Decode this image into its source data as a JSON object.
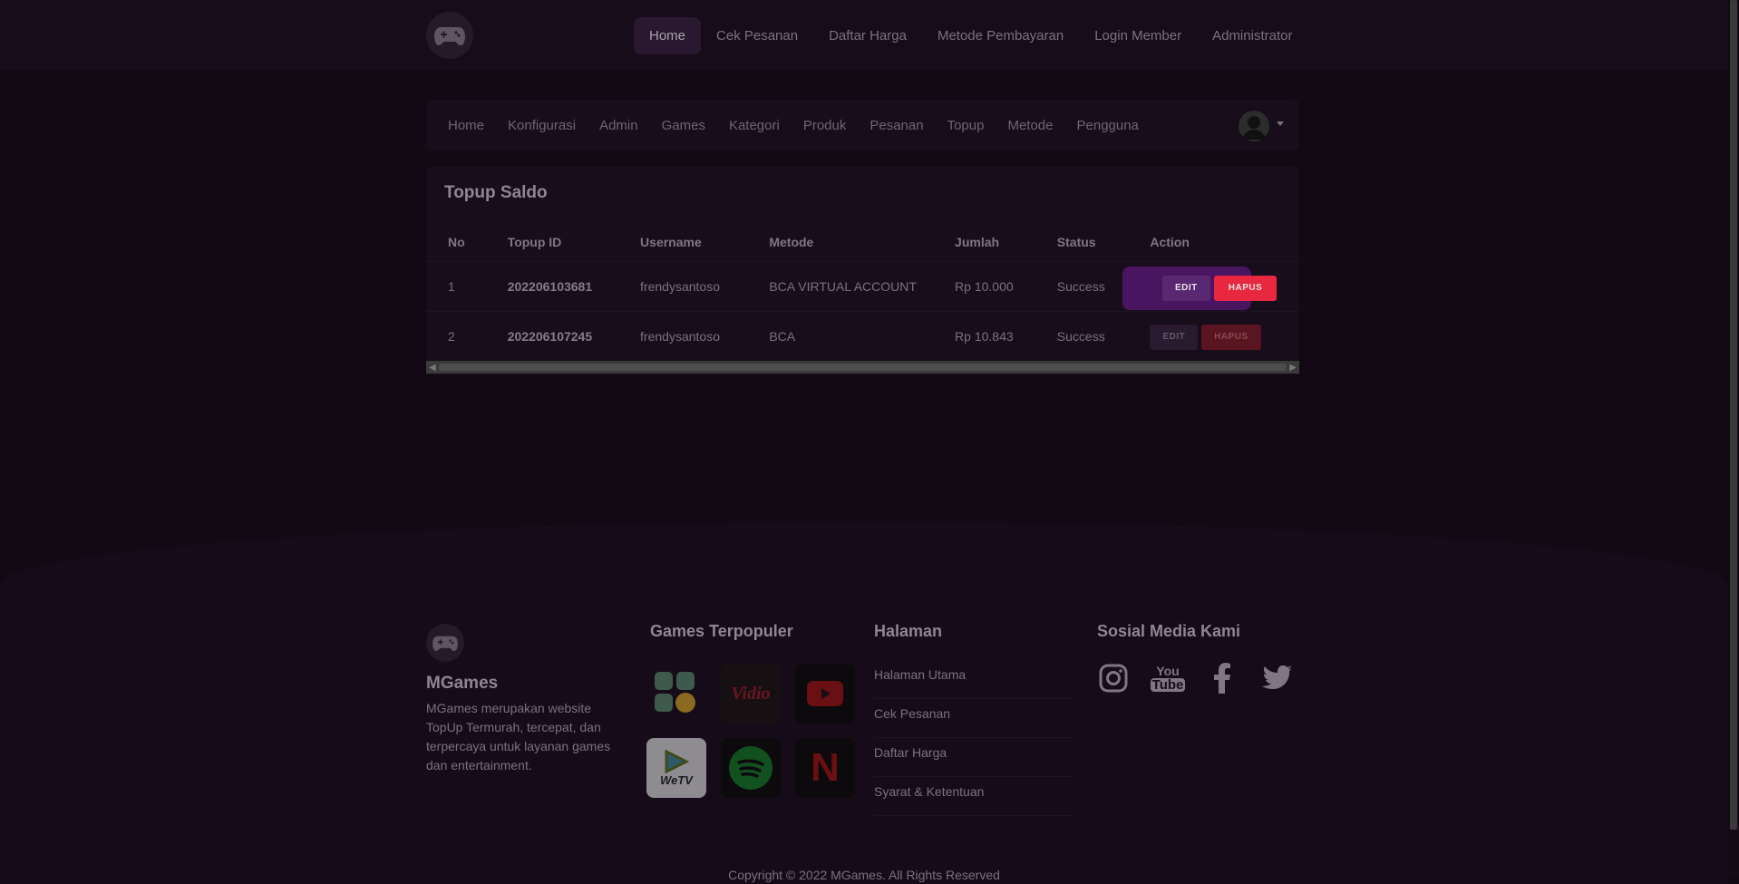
{
  "nav": {
    "items": [
      "Home",
      "Cek Pesanan",
      "Daftar Harga",
      "Metode Pembayaran",
      "Login Member",
      "Administrator"
    ],
    "active": "Home"
  },
  "admin_nav": {
    "items": [
      "Home",
      "Konfigurasi",
      "Admin",
      "Games",
      "Kategori",
      "Produk",
      "Pesanan",
      "Topup",
      "Metode",
      "Pengguna"
    ]
  },
  "card": {
    "title": "Topup Saldo",
    "columns": [
      "No",
      "Topup ID",
      "Username",
      "Metode",
      "Jumlah",
      "Status",
      "Action"
    ],
    "rows": [
      {
        "no": "1",
        "id": "202206103681",
        "username": "frendysantoso",
        "metode": "BCA VIRTUAL ACCOUNT",
        "jumlah": "Rp 10.000",
        "status": "Success"
      },
      {
        "no": "2",
        "id": "202206107245",
        "username": "frendysantoso",
        "metode": "BCA",
        "jumlah": "Rp 10.843",
        "status": "Success"
      }
    ],
    "edit_label": "EDIT",
    "hapus_label": "HAPUS"
  },
  "footer": {
    "brand": "MGames",
    "description": "MGames merupakan website TopUp Termurah, tercepat, dan terpercaya untuk layanan games dan entertainment.",
    "games_heading": "Games Terpopuler",
    "games": [
      {
        "name": "apps-coin-icon",
        "label": "",
        "bg": "#1a1a1a"
      },
      {
        "name": "vidio-icon",
        "label": "Vidio",
        "bg": "#1a1a1a"
      },
      {
        "name": "youtube-icon",
        "label": "",
        "bg": "#0e0e0e"
      },
      {
        "name": "wetv-icon",
        "label": "WeTV",
        "bg": "#dcdcdc"
      },
      {
        "name": "spotify-icon",
        "label": "",
        "bg": "#0e0e0e"
      },
      {
        "name": "netflix-icon",
        "label": "N",
        "bg": "#0e0e0e"
      }
    ],
    "pages_heading": "Halaman",
    "pages": [
      "Halaman Utama",
      "Cek Pesanan",
      "Daftar Harga",
      "Syarat & Ketentuan"
    ],
    "social_heading": "Sosial Media Kami",
    "social": [
      "instagram-icon",
      "youtube-icon",
      "facebook-icon",
      "twitter-icon"
    ],
    "youtube_word_1": "You",
    "youtube_word_2": "Tube",
    "copyright": "Copyright © 2022 MGames. All Rights Reserved"
  }
}
